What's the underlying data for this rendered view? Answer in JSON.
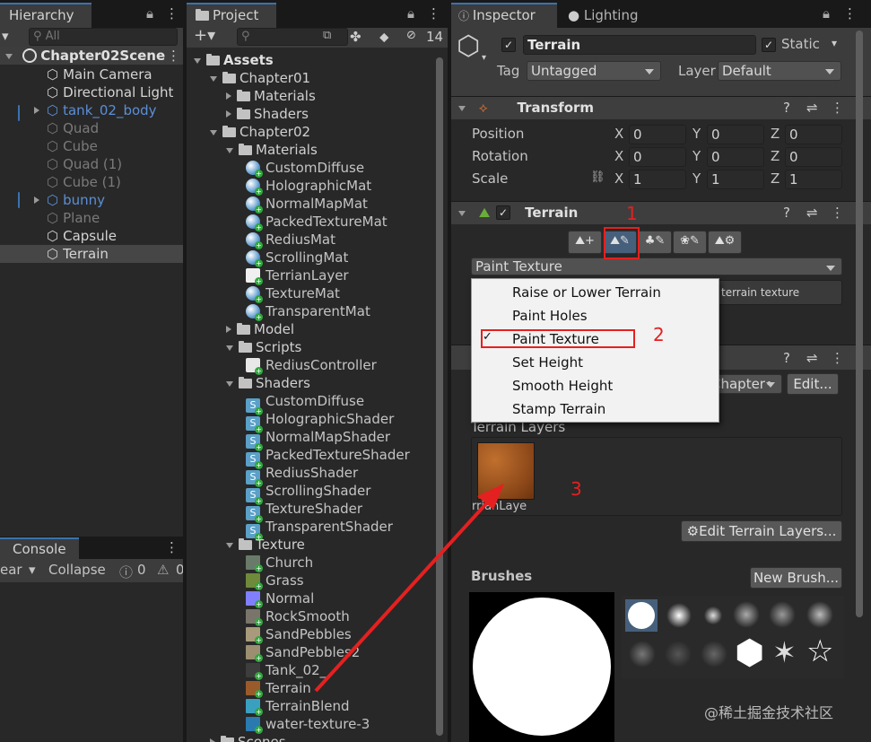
{
  "hierarchy": {
    "tab": "Hierarchy",
    "search_placeholder": "All",
    "scene": "Chapter02Scene",
    "items": [
      {
        "label": "Main Camera",
        "style": "normal",
        "expand": false
      },
      {
        "label": "Directional Light",
        "style": "normal",
        "expand": false
      },
      {
        "label": "tank_02_body",
        "style": "blue",
        "expand": true
      },
      {
        "label": "Quad",
        "style": "dim",
        "expand": false
      },
      {
        "label": "Cube",
        "style": "dim",
        "expand": false
      },
      {
        "label": "Quad (1)",
        "style": "dim",
        "expand": false
      },
      {
        "label": "Cube (1)",
        "style": "dim",
        "expand": false
      },
      {
        "label": "bunny",
        "style": "blue",
        "expand": true
      },
      {
        "label": "Plane",
        "style": "dim",
        "expand": false
      },
      {
        "label": "Capsule",
        "style": "normal",
        "expand": false
      },
      {
        "label": "Terrain",
        "style": "selected",
        "expand": false
      }
    ]
  },
  "console": {
    "tab": "Console",
    "clear": "ear",
    "collapse": "Collapse",
    "errors": "0",
    "warnings": "0"
  },
  "project": {
    "tab": "Project",
    "layer_count": "14",
    "tree": [
      {
        "label": "Assets",
        "type": "folder",
        "indent": 0,
        "open": true
      },
      {
        "label": "Chapter01",
        "type": "folder",
        "indent": 1,
        "open": true
      },
      {
        "label": "Materials",
        "type": "folder",
        "indent": 2,
        "open": false
      },
      {
        "label": "Shaders",
        "type": "folder",
        "indent": 2,
        "open": false
      },
      {
        "label": "Chapter02",
        "type": "folder",
        "indent": 1,
        "open": true
      },
      {
        "label": "Materials",
        "type": "folder",
        "indent": 2,
        "open": true
      },
      {
        "label": "CustomDiffuse",
        "type": "mat",
        "indent": 3
      },
      {
        "label": "HolographicMat",
        "type": "mat",
        "indent": 3
      },
      {
        "label": "NormalMapMat",
        "type": "mat",
        "indent": 3
      },
      {
        "label": "PackedTextureMat",
        "type": "mat",
        "indent": 3
      },
      {
        "label": "RediusMat",
        "type": "mat",
        "indent": 3
      },
      {
        "label": "ScrollingMat",
        "type": "mat",
        "indent": 3
      },
      {
        "label": "TerrianLayer",
        "type": "file",
        "indent": 3
      },
      {
        "label": "TextureMat",
        "type": "mat",
        "indent": 3
      },
      {
        "label": "TransparentMat",
        "type": "mat",
        "indent": 3
      },
      {
        "label": "Model",
        "type": "folder",
        "indent": 2,
        "open": false
      },
      {
        "label": "Scripts",
        "type": "folder",
        "indent": 2,
        "open": true
      },
      {
        "label": "RediusController",
        "type": "script",
        "indent": 3
      },
      {
        "label": "Shaders",
        "type": "folder",
        "indent": 2,
        "open": true
      },
      {
        "label": "CustomDiffuse",
        "type": "shader",
        "indent": 3
      },
      {
        "label": "HolographicShader",
        "type": "shader",
        "indent": 3
      },
      {
        "label": "NormalMapShader",
        "type": "shader",
        "indent": 3
      },
      {
        "label": "PackedTextureShader",
        "type": "shader",
        "indent": 3
      },
      {
        "label": "RediusShader",
        "type": "shader",
        "indent": 3
      },
      {
        "label": "ScrollingShader",
        "type": "shader",
        "indent": 3
      },
      {
        "label": "TextureShader",
        "type": "shader",
        "indent": 3
      },
      {
        "label": "TransparentShader",
        "type": "shader",
        "indent": 3
      },
      {
        "label": "Texture",
        "type": "folder",
        "indent": 2,
        "open": true
      },
      {
        "label": "Church",
        "type": "tex",
        "indent": 3,
        "color": "#6a7a6a"
      },
      {
        "label": "Grass",
        "type": "tex",
        "indent": 3,
        "color": "#6f8a3a"
      },
      {
        "label": "Normal",
        "type": "tex",
        "indent": 3,
        "color": "#8080ff"
      },
      {
        "label": "RockSmooth",
        "type": "tex",
        "indent": 3,
        "color": "#7a756a"
      },
      {
        "label": "SandPebbles",
        "type": "tex",
        "indent": 3,
        "color": "#a89a7a"
      },
      {
        "label": "SandPebbles2",
        "type": "tex",
        "indent": 3,
        "color": "#9c8e70"
      },
      {
        "label": "Tank_02_",
        "type": "tex",
        "indent": 3,
        "color": "#3d3d3d"
      },
      {
        "label": "Terrain",
        "type": "tex",
        "indent": 3,
        "color": "#9a5a2a"
      },
      {
        "label": "TerrainBlend",
        "type": "tex",
        "indent": 3,
        "color": "#3aa0c0"
      },
      {
        "label": "water-texture-3",
        "type": "tex",
        "indent": 3,
        "color": "#2a7ab0"
      },
      {
        "label": "Scenes",
        "type": "folder",
        "indent": 1,
        "open": false
      }
    ]
  },
  "inspector": {
    "tab": "Inspector",
    "tab2": "Lighting",
    "object_name": "Terrain",
    "static": "Static",
    "tag_label": "Tag",
    "tag": "Untagged",
    "layer_label": "Layer",
    "layer": "Default",
    "transform": {
      "title": "Transform",
      "position": "Position",
      "rotation": "Rotation",
      "scale": "Scale",
      "pos": [
        "0",
        "0",
        "0"
      ],
      "rot": [
        "0",
        "0",
        "0"
      ],
      "scl": [
        "1",
        "1",
        "1"
      ],
      "x": "X",
      "y": "Y",
      "z": "Z"
    },
    "terrain": {
      "title": "Terrain",
      "tool_dropdown": "Paint Texture",
      "hint": "terrain texture",
      "chapter_field": "Chapter•",
      "edit_btn": "Edit...",
      "layers_label": "Terrain Layers",
      "layer_name": "rrianLaye",
      "edit_layers_btn": "Edit Terrain Layers...",
      "brushes_label": "Brushes",
      "new_brush_btn": "New Brush..."
    },
    "menu": {
      "items": [
        "Raise or Lower Terrain",
        "Paint Holes",
        "Paint Texture",
        "Set Height",
        "Smooth Height",
        "Stamp Terrain"
      ],
      "checked_index": 2
    }
  },
  "annotations": {
    "n1": "1",
    "n2": "2",
    "n3": "3",
    "watermark": "@稀土掘金技术社区",
    "color": "#e52020"
  }
}
